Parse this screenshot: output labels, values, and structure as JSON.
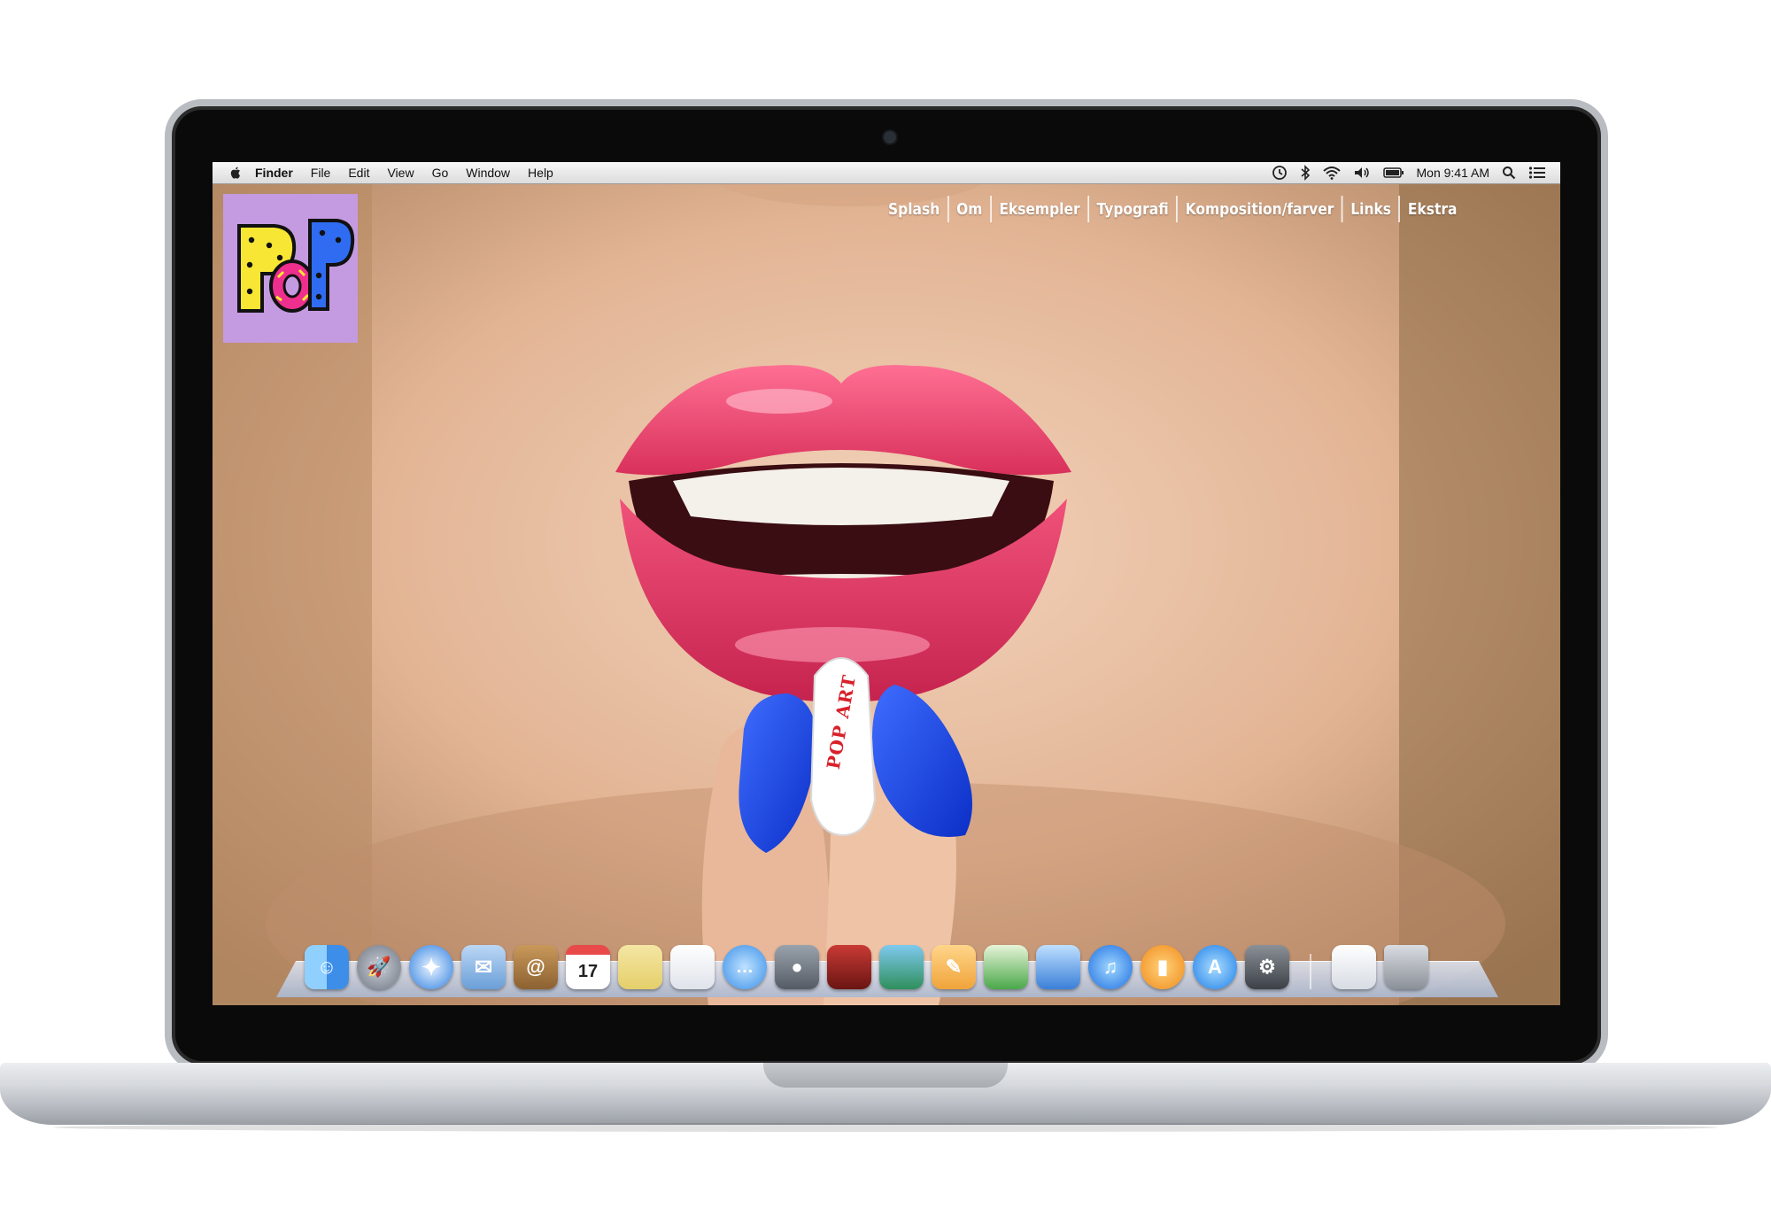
{
  "menubar": {
    "app_name": "Finder",
    "items": [
      "File",
      "Edit",
      "View",
      "Go",
      "Window",
      "Help"
    ],
    "clock": "Mon 9:41 AM"
  },
  "site": {
    "logo_text": "PoP",
    "nav": [
      "Splash",
      "Om",
      "Eksempler",
      "Typografi",
      "Komposition/farver",
      "Links",
      "Ekstra"
    ],
    "pill_text": "POP ART"
  },
  "dock": {
    "calendar_date": "17",
    "apps": [
      "finder-icon",
      "launchpad-icon",
      "safari-icon",
      "mail-icon",
      "contacts-icon",
      "calendar-icon",
      "notes-icon",
      "reminders-icon",
      "messages-icon",
      "facetime-icon",
      "photo-booth-icon",
      "iphoto-icon",
      "pages-icon",
      "numbers-icon",
      "keynote-icon",
      "itunes-icon",
      "ibooks-icon",
      "app-store-icon",
      "system-preferences-icon",
      "documents-icon",
      "trash-icon"
    ]
  },
  "colors": {
    "menubar": "#e8e8e8",
    "logo_bg": "#c49ae0",
    "lips": "#e8456e",
    "nails": "#1f4de8",
    "pill_text": "#d8212a"
  }
}
